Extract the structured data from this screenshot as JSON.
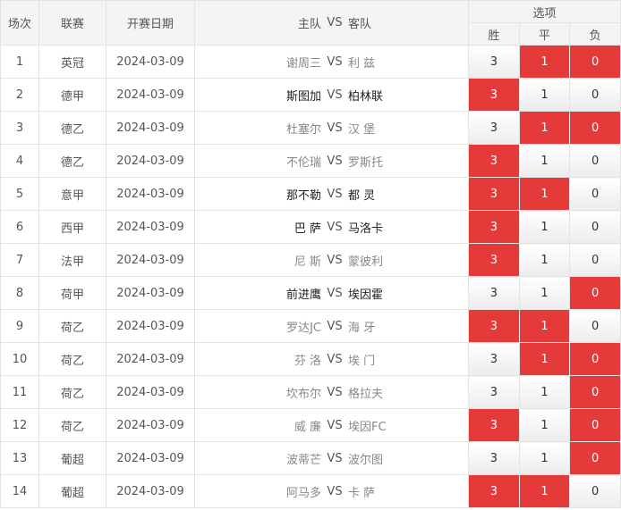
{
  "headers": {
    "index": "场次",
    "league": "联赛",
    "date": "开赛日期",
    "match_home": "主队",
    "match_vs": "VS",
    "match_away": "客队",
    "options": "选项",
    "win": "胜",
    "draw": "平",
    "lose": "负"
  },
  "colors": {
    "selected": "#e53a3a",
    "border": "#e3e3e3",
    "header_bg": "#f4f4f4"
  },
  "rows": [
    {
      "index": "1",
      "league": "英冠",
      "date": "2024-03-09",
      "home": "谢周三",
      "vs": "VS",
      "away": "利 兹",
      "home_dark": false,
      "away_dark": false,
      "win": "3",
      "draw": "1",
      "lose": "0",
      "win_sel": false,
      "draw_sel": true,
      "lose_sel": true
    },
    {
      "index": "2",
      "league": "德甲",
      "date": "2024-03-09",
      "home": "斯图加",
      "vs": "VS",
      "away": "柏林联",
      "home_dark": true,
      "away_dark": true,
      "win": "3",
      "draw": "1",
      "lose": "0",
      "win_sel": true,
      "draw_sel": false,
      "lose_sel": false
    },
    {
      "index": "3",
      "league": "德乙",
      "date": "2024-03-09",
      "home": "杜塞尔",
      "vs": "VS",
      "away": "汉 堡",
      "home_dark": false,
      "away_dark": false,
      "win": "3",
      "draw": "1",
      "lose": "0",
      "win_sel": false,
      "draw_sel": true,
      "lose_sel": true
    },
    {
      "index": "4",
      "league": "德乙",
      "date": "2024-03-09",
      "home": "不伦瑞",
      "vs": "VS",
      "away": "罗斯托",
      "home_dark": false,
      "away_dark": false,
      "win": "3",
      "draw": "1",
      "lose": "0",
      "win_sel": true,
      "draw_sel": false,
      "lose_sel": false
    },
    {
      "index": "5",
      "league": "意甲",
      "date": "2024-03-09",
      "home": "那不勒",
      "vs": "VS",
      "away": "都 灵",
      "home_dark": true,
      "away_dark": true,
      "win": "3",
      "draw": "1",
      "lose": "0",
      "win_sel": true,
      "draw_sel": true,
      "lose_sel": false
    },
    {
      "index": "6",
      "league": "西甲",
      "date": "2024-03-09",
      "home": "巴 萨",
      "vs": "VS",
      "away": "马洛卡",
      "home_dark": true,
      "away_dark": true,
      "win": "3",
      "draw": "1",
      "lose": "0",
      "win_sel": true,
      "draw_sel": false,
      "lose_sel": false
    },
    {
      "index": "7",
      "league": "法甲",
      "date": "2024-03-09",
      "home": "尼 斯",
      "vs": "VS",
      "away": "蒙彼利",
      "home_dark": false,
      "away_dark": false,
      "win": "3",
      "draw": "1",
      "lose": "0",
      "win_sel": true,
      "draw_sel": false,
      "lose_sel": false
    },
    {
      "index": "8",
      "league": "荷甲",
      "date": "2024-03-09",
      "home": "前进鹰",
      "vs": "VS",
      "away": "埃因霍",
      "home_dark": true,
      "away_dark": true,
      "win": "3",
      "draw": "1",
      "lose": "0",
      "win_sel": false,
      "draw_sel": false,
      "lose_sel": true
    },
    {
      "index": "9",
      "league": "荷乙",
      "date": "2024-03-09",
      "home": "罗达JC",
      "vs": "VS",
      "away": "海 牙",
      "home_dark": false,
      "away_dark": false,
      "win": "3",
      "draw": "1",
      "lose": "0",
      "win_sel": true,
      "draw_sel": true,
      "lose_sel": false
    },
    {
      "index": "10",
      "league": "荷乙",
      "date": "2024-03-09",
      "home": "芬 洛",
      "vs": "VS",
      "away": "埃 门",
      "home_dark": false,
      "away_dark": false,
      "win": "3",
      "draw": "1",
      "lose": "0",
      "win_sel": false,
      "draw_sel": true,
      "lose_sel": true
    },
    {
      "index": "11",
      "league": "荷乙",
      "date": "2024-03-09",
      "home": "坎布尔",
      "vs": "VS",
      "away": "格拉夫",
      "home_dark": false,
      "away_dark": false,
      "win": "3",
      "draw": "1",
      "lose": "0",
      "win_sel": false,
      "draw_sel": false,
      "lose_sel": true
    },
    {
      "index": "12",
      "league": "荷乙",
      "date": "2024-03-09",
      "home": "威 廉",
      "vs": "VS",
      "away": "埃因FC",
      "home_dark": false,
      "away_dark": false,
      "win": "3",
      "draw": "1",
      "lose": "0",
      "win_sel": true,
      "draw_sel": false,
      "lose_sel": true
    },
    {
      "index": "13",
      "league": "葡超",
      "date": "2024-03-09",
      "home": "波蒂芒",
      "vs": "VS",
      "away": "波尔图",
      "home_dark": false,
      "away_dark": false,
      "win": "3",
      "draw": "1",
      "lose": "0",
      "win_sel": false,
      "draw_sel": false,
      "lose_sel": true
    },
    {
      "index": "14",
      "league": "葡超",
      "date": "2024-03-09",
      "home": "阿马多",
      "vs": "VS",
      "away": "卡 萨",
      "home_dark": false,
      "away_dark": false,
      "win": "3",
      "draw": "1",
      "lose": "0",
      "win_sel": true,
      "draw_sel": true,
      "lose_sel": false
    }
  ]
}
